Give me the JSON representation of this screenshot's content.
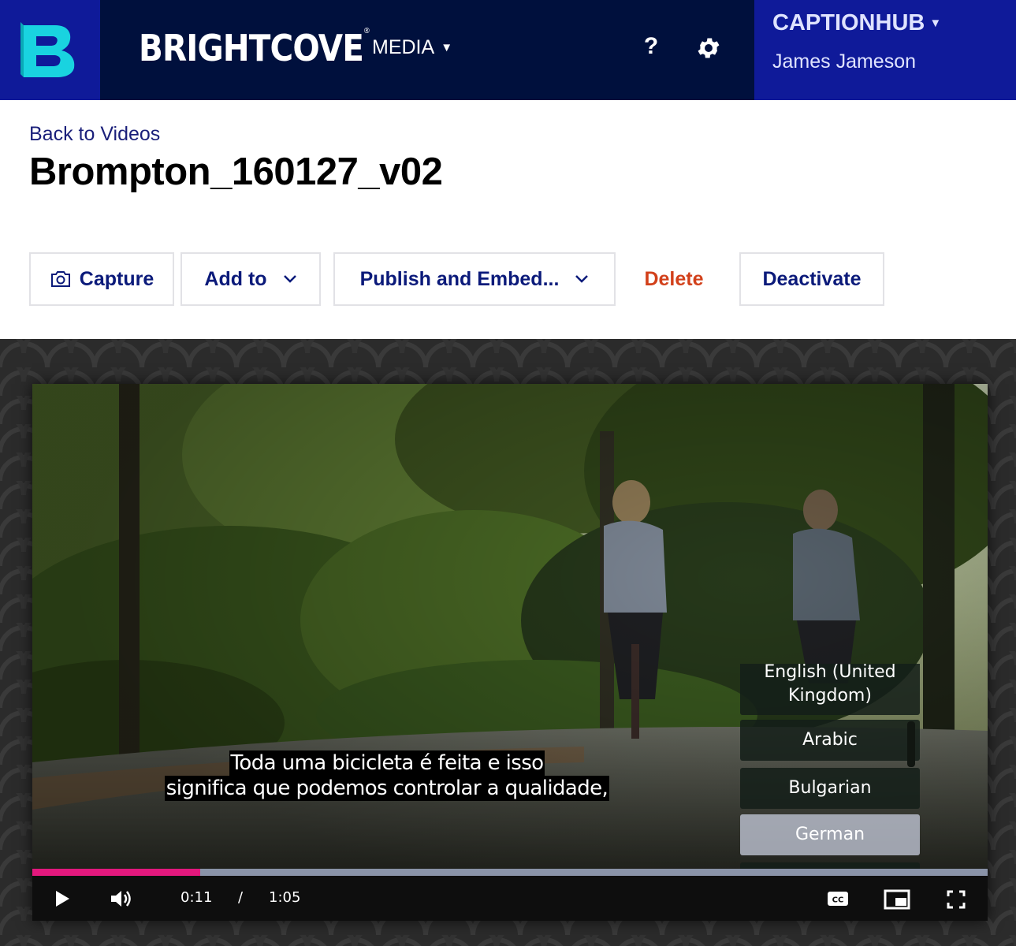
{
  "header": {
    "brand": "BRIGHTCOVE",
    "brand_mark": "®",
    "media_menu": "MEDIA",
    "help_label": "?",
    "account_name": "CAPTIONHUB",
    "user_name": "James Jameson",
    "colors": {
      "navbar": "#00103d",
      "accent": "#0f1a99",
      "logo": "#19d3e0"
    },
    "icons": {
      "logo": "brightcove-b-logo",
      "help": "help-icon",
      "settings": "gear-icon",
      "dropdown": "caret-down-icon"
    }
  },
  "page": {
    "back_link": "Back to Videos",
    "title": "Brompton_160127_v02"
  },
  "toolbar": {
    "capture": "Capture",
    "add_to": "Add to",
    "publish": "Publish and Embed...",
    "delete": "Delete",
    "deactivate": "Deactivate",
    "colors": {
      "primary": "#0b1a7a",
      "danger": "#d2401a"
    }
  },
  "player": {
    "captions": [
      "Toda uma bicicleta é feita e isso",
      "significa que podemos controlar a qualidade,"
    ],
    "languages": [
      {
        "label": "English (United Kingdom)",
        "selected": false
      },
      {
        "label": "Arabic",
        "selected": false
      },
      {
        "label": "Bulgarian",
        "selected": false
      },
      {
        "label": "German",
        "selected": true
      }
    ],
    "current_time": "0:11",
    "separator": "/",
    "duration": "1:05",
    "progress": 0.176,
    "colors": {
      "progress": "#e3187d"
    },
    "icons": [
      "play-icon",
      "volume-icon",
      "closed-captions-icon",
      "picture-in-picture-icon",
      "fullscreen-icon"
    ]
  }
}
